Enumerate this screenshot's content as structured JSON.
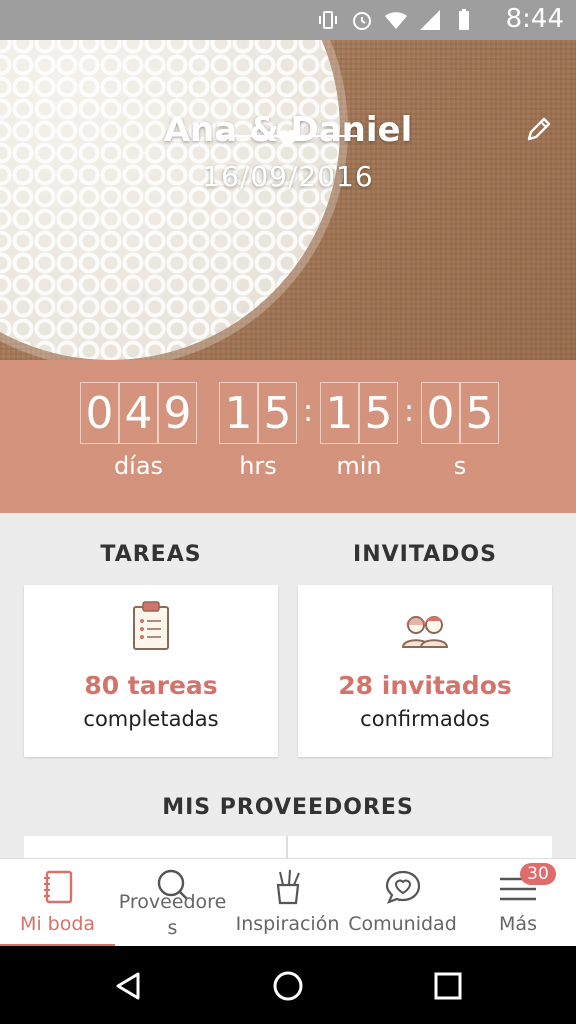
{
  "status_bar": {
    "time": "8:44",
    "icons": [
      "vibrate-icon",
      "alarm-icon",
      "wifi-icon",
      "signal-icon",
      "battery-icon"
    ]
  },
  "hero": {
    "couple_names": "Ana & Daniel",
    "date": "16/09/2016",
    "edit_icon": "pencil-icon"
  },
  "countdown": {
    "days_digits": [
      "0",
      "4",
      "9"
    ],
    "hours_digits": [
      "1",
      "5"
    ],
    "minutes_digits": [
      "1",
      "5"
    ],
    "seconds_digits": [
      "0",
      "5"
    ],
    "labels": {
      "days": "días",
      "hours": "hrs",
      "minutes": "min",
      "seconds": "s"
    },
    "separator": ":"
  },
  "sections": {
    "tasks_title": "TAREAS",
    "guests_title": "INVITADOS",
    "providers_title": "MIS PROVEEDORES"
  },
  "cards": {
    "tasks": {
      "count_text": "80 tareas",
      "sub_text": "completadas",
      "icon": "clipboard-checklist-icon"
    },
    "guests": {
      "count_text": "28 invitados",
      "sub_text": "confirmados",
      "icon": "couple-icon"
    }
  },
  "tabbar": {
    "items": [
      {
        "label": "Mi boda",
        "icon": "notebook-icon",
        "active": true
      },
      {
        "label": "Proveedores",
        "icon": "search-icon",
        "active": false
      },
      {
        "label": "Inspiración",
        "icon": "brush-cup-icon",
        "active": false
      },
      {
        "label": "Comunidad",
        "icon": "chat-heart-icon",
        "active": false
      },
      {
        "label": "Más",
        "icon": "menu-icon",
        "active": false,
        "badge": "30"
      }
    ]
  },
  "colors": {
    "accent": "#d4736a",
    "countdown_bg": "#d4937c",
    "status_bar": "#9e9e9e"
  }
}
